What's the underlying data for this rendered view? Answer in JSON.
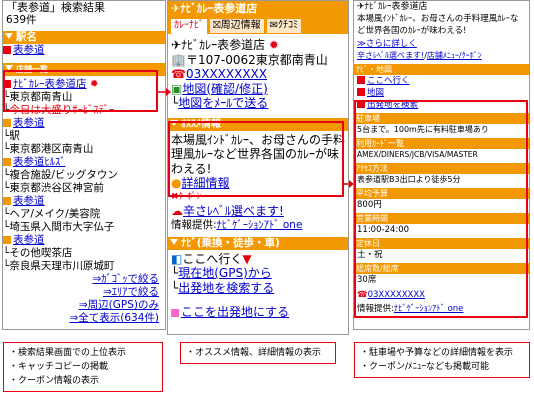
{
  "left": {
    "title": "「表参道」検索結果",
    "count": "639件",
    "sec_ekimei": "駅名",
    "ekimei_link": "表参道",
    "sec_shop": "店舗一覧",
    "shop_name": "ﾅﾋﾞｶﾚｰ表参道店",
    "shop_addr": "東京都南青山",
    "shop_copy": "今日は大盛りｻｰﾋﾞｽﾃﾞｰ",
    "link_omotesando2": "表参道",
    "station_label": "駅",
    "station_addr": "東京都港区南青山",
    "link_hills": "表参道ﾋﾙｽﾞ",
    "complex_label": "複合施設/ビッグタウン",
    "complex_addr": "東京都渋谷区神宮前",
    "link_omotesando3": "表参道",
    "hair_label": "ヘア/メイク/美容院",
    "hair_addr": "埼玉県入間市大字仏子",
    "link_omotesando4": "表参道",
    "other_label": "その他喫茶店",
    "other_addr": "奈良県天理市川原城町",
    "links": [
      "⇒ｶﾞｺﾞｯで絞る",
      "⇒ｴﾘｱで絞る",
      "⇒周辺(GPS)のみ",
      "⇒全て表示(634件)"
    ]
  },
  "mid": {
    "header": "ﾅﾋﾞｶﾚｰ表参道店",
    "tabs": [
      "ｶﾚｰﾅﾋﾞ",
      "周辺情報",
      "ｸﾁｺﾐ"
    ],
    "shop_title": "ﾅﾋﾞｶﾚｰ表参道店",
    "zip_addr": "〒107-0062東京都南青山",
    "tel": "03XXXXXXXX",
    "map_link": "地図(確認/修正)",
    "map_mail": "地図をﾒｰﾙで送る",
    "sec_recommend": "ｵｽｽﾒ情報",
    "recommend_text": "本場風ｲﾝﾄﾞｶﾚｰ、お母さんの手料理風ｶﾚｰなど世界各国のｶﾚｰが味わえる!",
    "detail_link": "詳細情報",
    "coupon_label": "ｸｰﾎﾟﾝ",
    "coupon_link": "辛さﾚﾍﾞﾙ選べます!",
    "info_provider": "情報提供:",
    "info_provider_link": "ﾅﾋﾞｹﾞｰｼｮﾝｱﾄﾞ one",
    "sec_navi": "ﾅﾋﾞ(乗換・徒歩・車)",
    "navi_goto": "ここへ行く",
    "navi_gps": "現在地(GPS)から",
    "navi_search": "出発地を検索する",
    "navi_start": "ここを出発地にする"
  },
  "right": {
    "header": "ﾅﾋﾞｶﾚｰ表参道店",
    "desc": "本場風ｲﾝﾄﾞｶﾚｰ、お母さんの手料理風ｶﾚｰなど世界各国のｶﾚｰが味わえる!",
    "more_link": "≫さらに詳しく",
    "coupon_link": "辛さﾚﾍﾞﾙ選べます!",
    "coupon_tail": "店舗ﾒﾆｭｰ/ｸｰﾎﾟﾝ",
    "nav_label": "ﾅﾋﾞ・地図",
    "nav_links": [
      "ここへ行く",
      "地図",
      "出発地を検索"
    ],
    "parking_label": "駐車場",
    "parking_val": "5台まで。100m先に有料駐車場あり",
    "card_label": "利用ｶｰﾄﾞ一覧",
    "card_val": "AMEX/DINERS/JCB/VISA/MASTER",
    "access_label": "ｱｸｾｽ方法",
    "access_val": "表参道駅B3出口より徒歩5分",
    "budget_label": "平均予算",
    "budget_val": "800円",
    "hours_label": "営業時間",
    "hours_val": "11:00-24:00",
    "holiday_label": "定休日",
    "holiday_val": "土・祝",
    "seats_label": "総席数/総席",
    "seats_val": "30席",
    "tel": "03XXXXXXXX",
    "provider": "情報提供:",
    "provider_link": "ﾅﾋﾞｹﾞｰｼｮﾝｱﾄﾞ one"
  },
  "notes": {
    "left": [
      "・検索結果画面での上位表示",
      "・キャッチコピーの掲載",
      "・クーポン情報の表示"
    ],
    "mid": [
      "・オススメ情報、詳細情報の表示"
    ],
    "right": [
      "・駐車場や予算などの詳細情報を表示",
      "・クーポン/ﾒﾆｭｰなども掲載可能"
    ]
  }
}
